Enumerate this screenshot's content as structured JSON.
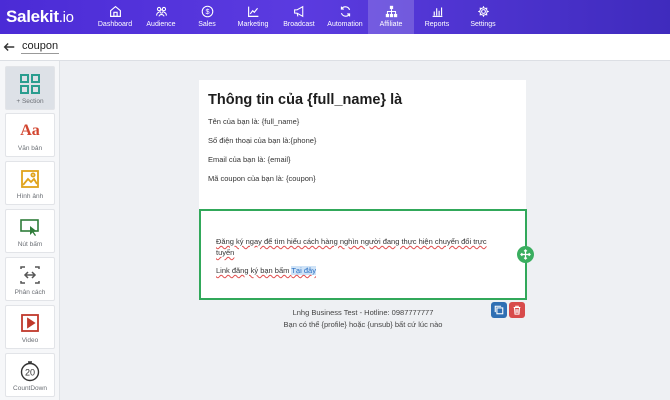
{
  "app": {
    "logo_main": "Salekit",
    "logo_suffix": ".io"
  },
  "nav": [
    {
      "label": "Dashboard",
      "icon": "home-icon",
      "active": false
    },
    {
      "label": "Audience",
      "icon": "users-icon",
      "active": false
    },
    {
      "label": "Sales",
      "icon": "dollar-icon",
      "active": false
    },
    {
      "label": "Marketing",
      "icon": "chart-line-icon",
      "active": false
    },
    {
      "label": "Broadcast",
      "icon": "megaphone-icon",
      "active": false
    },
    {
      "label": "Automation",
      "icon": "refresh-icon",
      "active": false
    },
    {
      "label": "Affiliate",
      "icon": "network-icon",
      "active": true
    },
    {
      "label": "Reports",
      "icon": "bar-chart-icon",
      "active": false
    },
    {
      "label": "Settings",
      "icon": "gear-icon",
      "active": false
    }
  ],
  "page": {
    "name": "coupon"
  },
  "tools": [
    {
      "label": "+ Section",
      "icon": "grid-icon"
    },
    {
      "label": "Văn bản",
      "icon": "text-icon",
      "glyph": "Aa"
    },
    {
      "label": "Hình ảnh",
      "icon": "image-icon"
    },
    {
      "label": "Nút bấm",
      "icon": "button-icon"
    },
    {
      "label": "Phân cách",
      "icon": "divider-icon"
    },
    {
      "label": "Video",
      "icon": "video-icon"
    },
    {
      "label": "CountDown",
      "icon": "countdown-icon",
      "glyph": "20"
    }
  ],
  "email": {
    "title": "Thông tin của {full_name} là",
    "lines": [
      "Tên của bạn là: {full_name}",
      "Số điện thoại của bạn là:{phone}",
      "Email của bạn là: {email}",
      "Mã coupon của bạn là: {coupon}"
    ],
    "selected_block": {
      "paragraph": "Đăng ký ngay để tìm hiểu cách hàng nghìn người đang thực hiện chuyển đổi trực tuyến",
      "link_prefix": "Link đăng ký bạn bấm ",
      "link_text": "Tại đây"
    },
    "footer_line1": "Lnhg Business Test - Hotline: 0987777777",
    "footer_line2": "Bạn có thể {profile} hoặc {unsub} bất cứ lúc nào"
  },
  "colors": {
    "topbar": "#4b2bd6",
    "selection": "#31a85a",
    "copy_button": "#2f6fb3",
    "delete_button": "#d84b4b"
  }
}
